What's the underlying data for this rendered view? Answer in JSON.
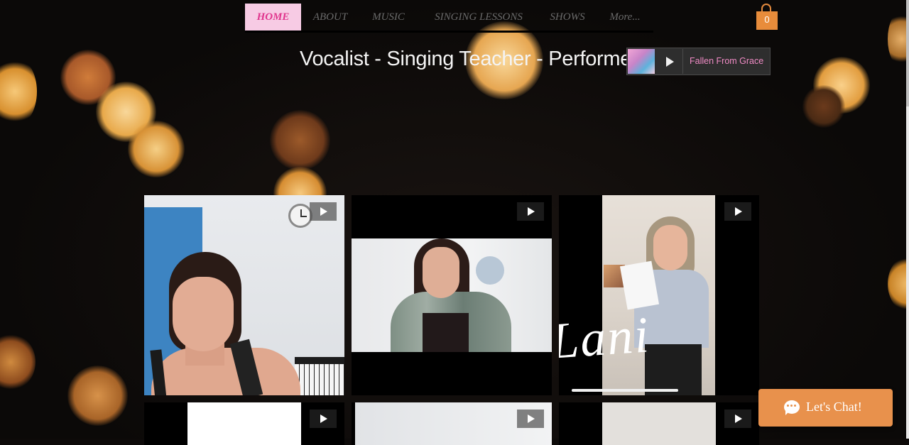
{
  "nav": {
    "items": [
      {
        "label": "HOME",
        "active": true
      },
      {
        "label": "ABOUT",
        "active": false
      },
      {
        "label": "MUSIC",
        "active": false
      },
      {
        "label": "SINGING LESSONS",
        "active": false
      },
      {
        "label": "SHOWS",
        "active": false
      },
      {
        "label": "More...",
        "active": false
      }
    ]
  },
  "cart": {
    "count": "0",
    "icon": "shopping-bag-icon"
  },
  "headline": "Vocalist - Singing Teacher - Performer",
  "player": {
    "track": "Fallen From Grace",
    "icon": "play-icon"
  },
  "gallery": {
    "tiles": [
      {
        "icon": "play-icon"
      },
      {
        "icon": "play-icon"
      },
      {
        "icon": "play-icon",
        "signature": "Lani"
      },
      {
        "icon": "play-icon"
      },
      {
        "icon": "play-icon"
      },
      {
        "icon": "play-icon"
      }
    ]
  },
  "chat": {
    "label": "Let's Chat!",
    "icon": "chat-bubble-icon"
  },
  "colors": {
    "nav_active_bg": "#f7cbe4",
    "nav_active_text": "#e0358d",
    "accent_orange": "#e8914c",
    "track_pink": "#f08bc5"
  }
}
